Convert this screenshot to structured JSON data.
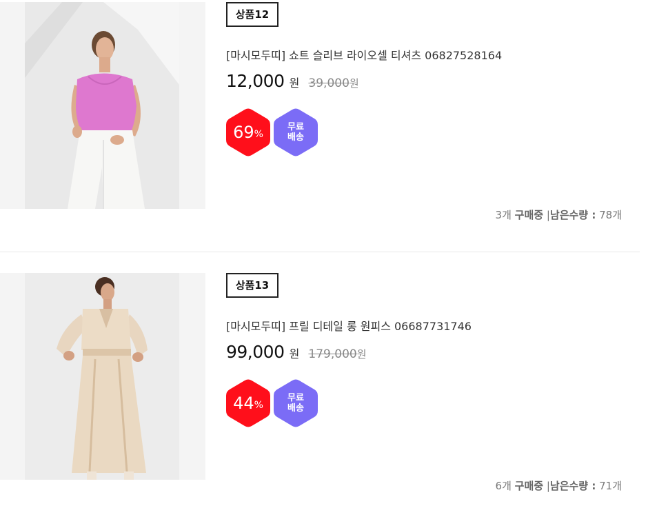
{
  "products": [
    {
      "tag": "상품12",
      "title": "[마시모두띠] 쇼트 슬리브 라이오셀 티셔츠 06827528164",
      "price": "12,000",
      "price_unit": "원",
      "original_price": "39,000",
      "original_unit": "원",
      "discount_value": "69",
      "discount_unit": "%",
      "shipping_line1": "무료",
      "shipping_line2": "배송",
      "buying_count": "3개",
      "buying_label": "구매중",
      "separator": "|",
      "remaining_label": "남은수량 :",
      "remaining_count": "78개",
      "image_desc": "model-pink-top-white-pants"
    },
    {
      "tag": "상품13",
      "title": "[마시모두띠] 프릴 디테일 롱 원피스 06687731746",
      "price": "99,000",
      "price_unit": "원",
      "original_price": "179,000",
      "original_unit": "원",
      "discount_value": "44",
      "discount_unit": "%",
      "shipping_line1": "무료",
      "shipping_line2": "배송",
      "buying_count": "6개",
      "buying_label": "구매중",
      "separator": "|",
      "remaining_label": "남은수량 :",
      "remaining_count": "71개",
      "image_desc": "model-beige-long-dress"
    }
  ],
  "colors": {
    "discount_badge": "#ff0f1b",
    "shipping_badge": "#7b6cf6",
    "tag_border": "#222222",
    "strike_price": "#888888"
  }
}
